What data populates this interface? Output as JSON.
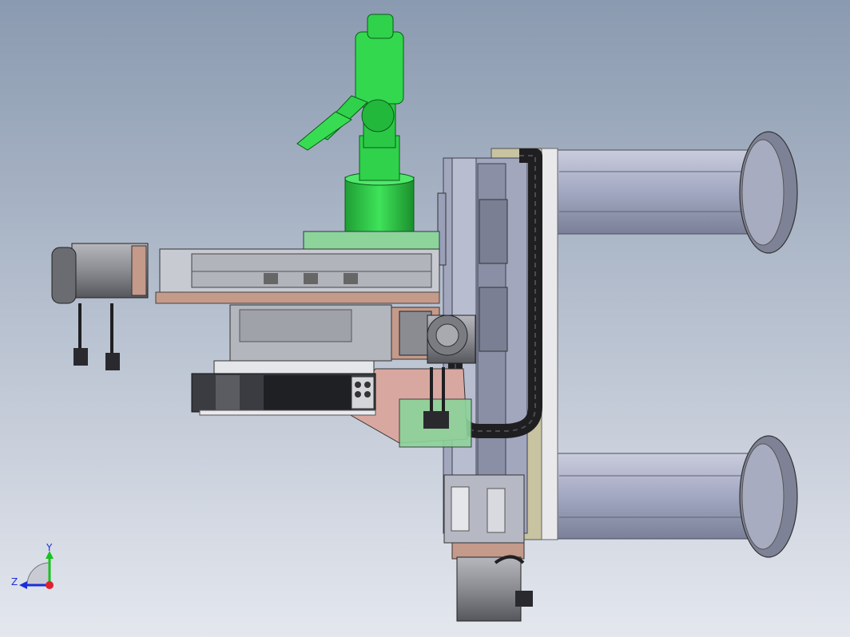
{
  "viewport": {
    "background_top": "#8a9ab0",
    "background_bottom": "#e4e7ee"
  },
  "colors": {
    "robot_arm": "#2fd24a",
    "robot_arm_dark": "#1a8f2c",
    "frame_steel": "#9aa0b8",
    "frame_dark": "#5d6275",
    "bracket_tan": "#c49a8a",
    "bracket_pink": "#d8a8a0",
    "plate_green": "#8cd49a",
    "motor_grey": "#8c8e94",
    "motor_dark": "#3d3f45",
    "cable_black": "#1f1f22"
  },
  "triad": {
    "y_label": "Y",
    "z_label": "Z",
    "y_color": "#18c21f",
    "z_color": "#1a2fd8",
    "origin_color": "#e0202c"
  }
}
